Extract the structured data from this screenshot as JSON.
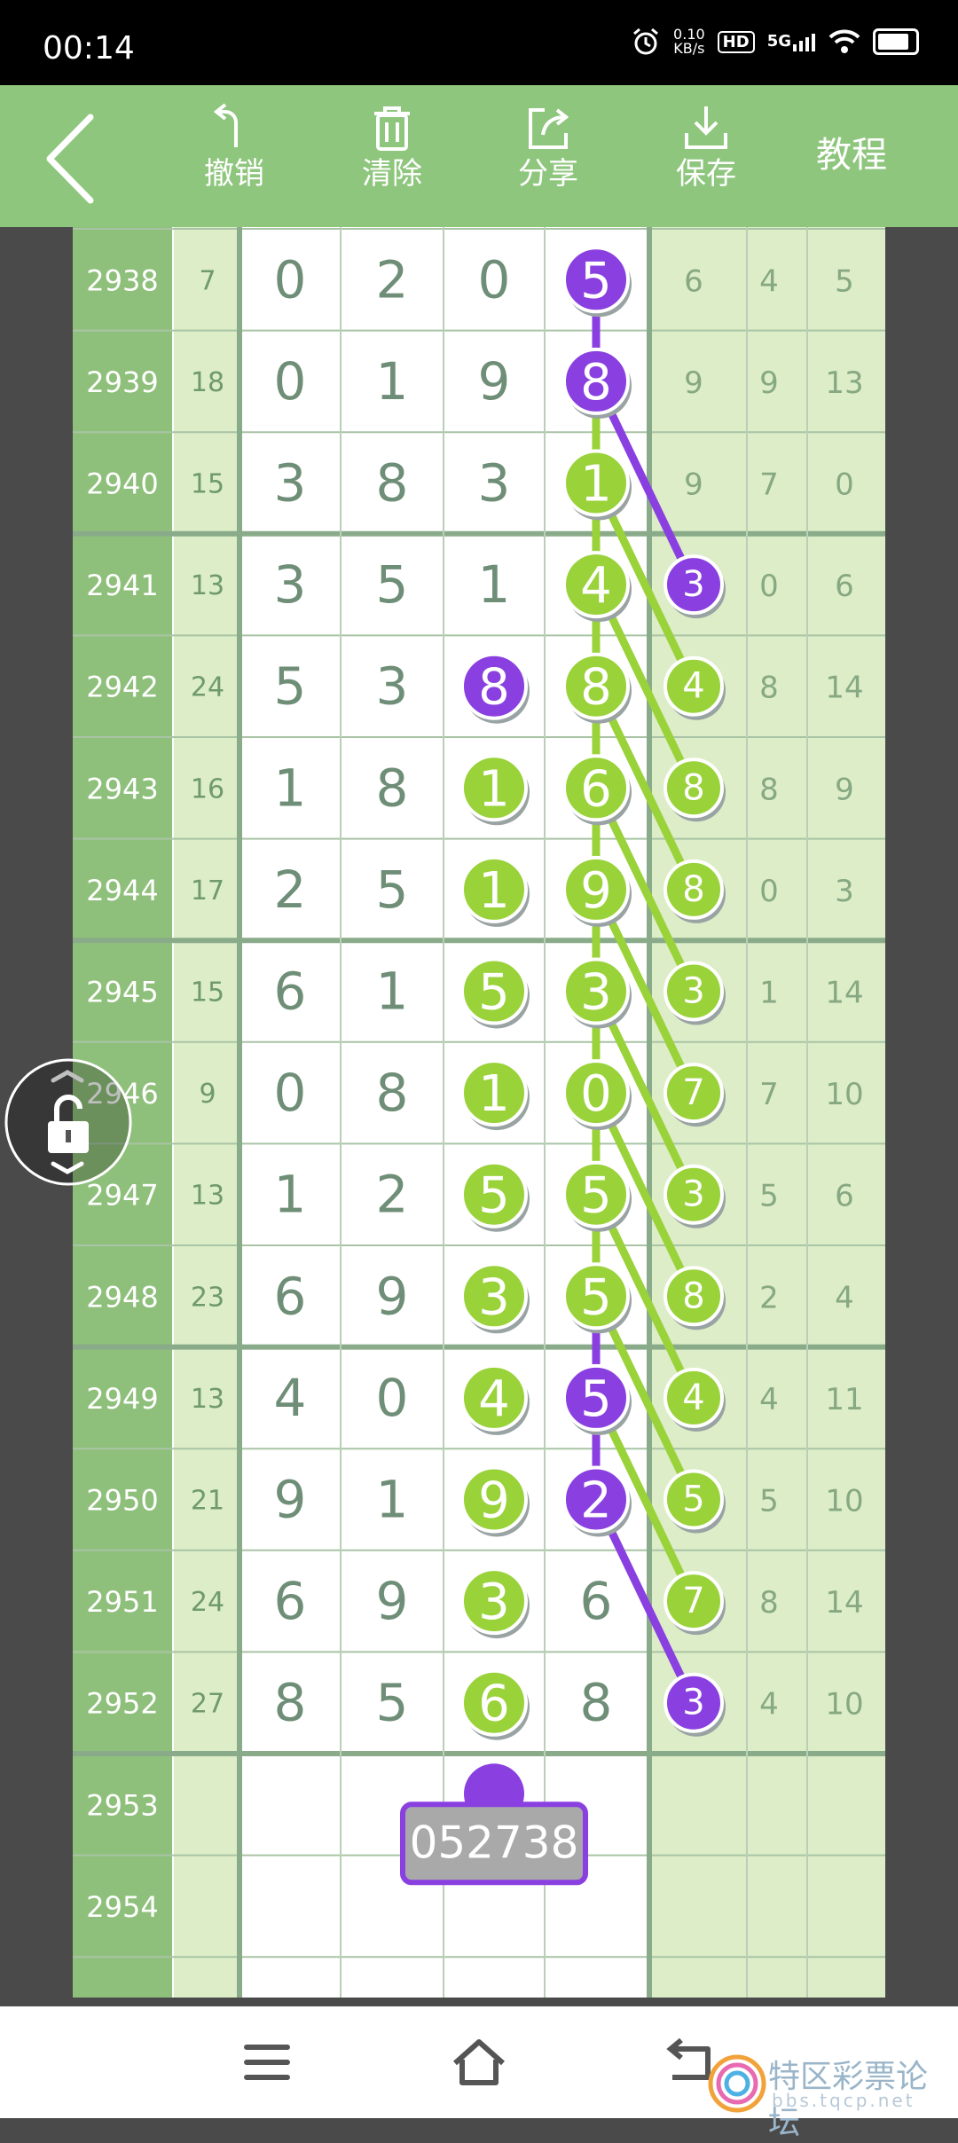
{
  "status": {
    "time": "00:14",
    "speed_value": "0.10",
    "speed_unit": "KB/s",
    "hd": "HD",
    "network": "5G"
  },
  "toolbar": {
    "undo_label": "撤销",
    "clear_label": "清除",
    "share_label": "分享",
    "save_label": "保存",
    "tutorial_label": "教程"
  },
  "colors": {
    "green": "#9ad23a",
    "purple": "#8a3fe0",
    "header_green": "#8fc67e",
    "cell_green": "#dcedc8",
    "id_green": "#8fc07b"
  },
  "grid": {
    "rows": [
      {
        "id": "2938",
        "sum": "7",
        "digits": [
          "0",
          "2",
          "0",
          "5"
        ],
        "stats": [
          "6",
          "4",
          "5"
        ]
      },
      {
        "id": "2939",
        "sum": "18",
        "digits": [
          "0",
          "1",
          "9",
          "8"
        ],
        "stats": [
          "9",
          "9",
          "13"
        ]
      },
      {
        "id": "2940",
        "sum": "15",
        "digits": [
          "3",
          "8",
          "3",
          "1"
        ],
        "stats": [
          "9",
          "7",
          "0"
        ]
      },
      {
        "id": "2941",
        "sum": "13",
        "digits": [
          "3",
          "5",
          "1",
          "4"
        ],
        "stats": [
          "3",
          "0",
          "6"
        ]
      },
      {
        "id": "2942",
        "sum": "24",
        "digits": [
          "5",
          "3",
          "8",
          "8"
        ],
        "stats": [
          "4",
          "8",
          "14"
        ]
      },
      {
        "id": "2943",
        "sum": "16",
        "digits": [
          "1",
          "8",
          "1",
          "6"
        ],
        "stats": [
          "8",
          "8",
          "9"
        ]
      },
      {
        "id": "2944",
        "sum": "17",
        "digits": [
          "2",
          "5",
          "1",
          "9"
        ],
        "stats": [
          "8",
          "0",
          "3"
        ]
      },
      {
        "id": "2945",
        "sum": "15",
        "digits": [
          "6",
          "1",
          "5",
          "3"
        ],
        "stats": [
          "3",
          "1",
          "14"
        ]
      },
      {
        "id": "2946",
        "sum": "9",
        "digits": [
          "0",
          "8",
          "1",
          "0"
        ],
        "stats": [
          "7",
          "7",
          "10"
        ]
      },
      {
        "id": "2947",
        "sum": "13",
        "digits": [
          "1",
          "2",
          "5",
          "5"
        ],
        "stats": [
          "3",
          "5",
          "6"
        ]
      },
      {
        "id": "2948",
        "sum": "23",
        "digits": [
          "6",
          "9",
          "3",
          "5"
        ],
        "stats": [
          "8",
          "2",
          "4"
        ]
      },
      {
        "id": "2949",
        "sum": "13",
        "digits": [
          "4",
          "0",
          "4",
          "5"
        ],
        "stats": [
          "4",
          "4",
          "11"
        ]
      },
      {
        "id": "2950",
        "sum": "21",
        "digits": [
          "9",
          "1",
          "9",
          "2"
        ],
        "stats": [
          "5",
          "5",
          "10"
        ]
      },
      {
        "id": "2951",
        "sum": "24",
        "digits": [
          "6",
          "9",
          "3",
          "6"
        ],
        "stats": [
          "7",
          "8",
          "14"
        ]
      },
      {
        "id": "2952",
        "sum": "27",
        "digits": [
          "8",
          "5",
          "6",
          "8"
        ],
        "stats": [
          "3",
          "4",
          "10"
        ]
      },
      {
        "id": "2953",
        "sum": "",
        "digits": [
          "",
          "",
          "",
          ""
        ],
        "stats": [
          "",
          "",
          ""
        ]
      },
      {
        "id": "2954",
        "sum": "",
        "digits": [
          "",
          "",
          "",
          ""
        ],
        "stats": [
          "",
          "",
          ""
        ]
      }
    ],
    "input_box_value": "052738"
  },
  "watermark": {
    "text": "特区彩票论坛",
    "url": "bbs.tqcp.net"
  }
}
